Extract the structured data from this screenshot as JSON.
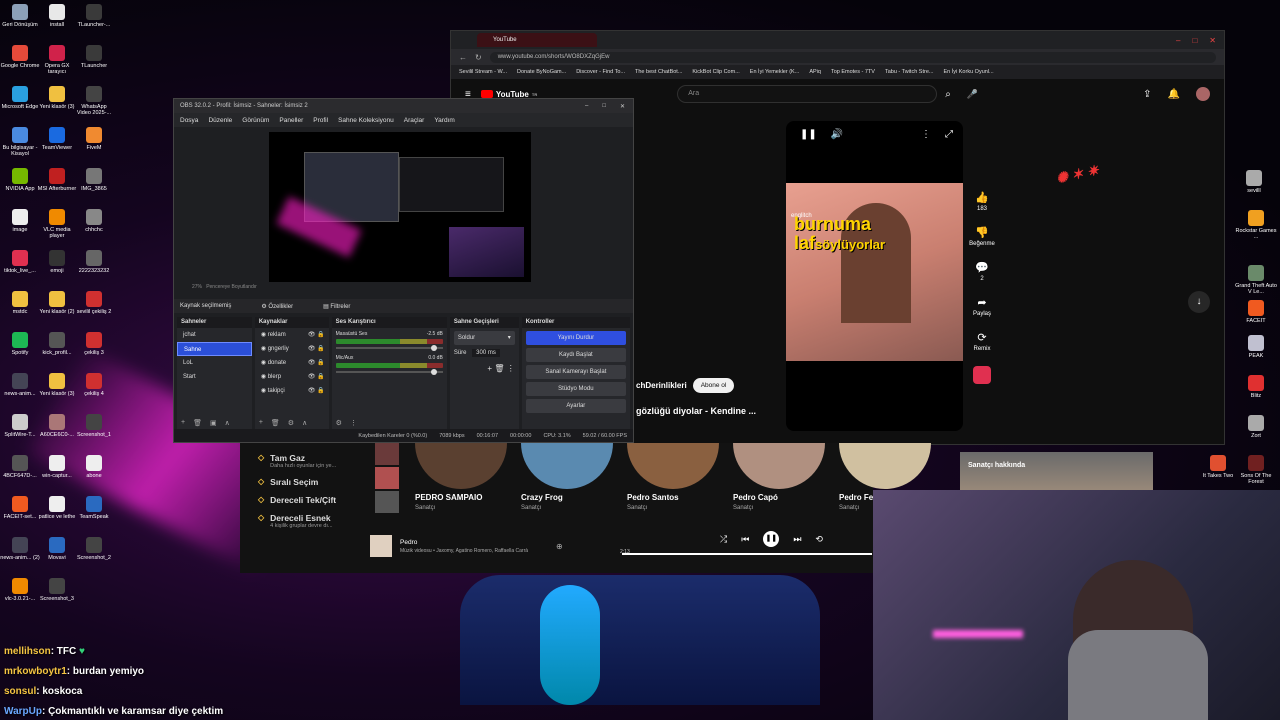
{
  "desktop_left": [
    {
      "label": "Geri Dönüşüm",
      "color": "#8ca0b8"
    },
    {
      "label": "install",
      "color": "#e8e8e8"
    },
    {
      "label": "TLauncher-...",
      "color": "#3a3a3a"
    },
    {
      "label": "Google Chrome",
      "color": "#e54a3a"
    },
    {
      "label": "Opera GX tarayıcı",
      "color": "#d0224a"
    },
    {
      "label": "TLauncher",
      "color": "#3a3a3a"
    },
    {
      "label": "Microsoft Edge",
      "color": "#2aa0e0"
    },
    {
      "label": "Yeni klasör (3)",
      "color": "#f0c040"
    },
    {
      "label": "WhatsApp Video 2025-...",
      "color": "#444"
    },
    {
      "label": "Bu bilgisayar - Kisayol",
      "color": "#4a8ae0"
    },
    {
      "label": "TeamViewer",
      "color": "#1a6ae0"
    },
    {
      "label": "FiveM",
      "color": "#f08a30"
    },
    {
      "label": "NVIDIA App",
      "color": "#76b900"
    },
    {
      "label": "MSI Afterburner",
      "color": "#c02020"
    },
    {
      "label": "IMG_3865",
      "color": "#777"
    },
    {
      "label": "image",
      "color": "#eee"
    },
    {
      "label": "VLC media player",
      "color": "#f08a00"
    },
    {
      "label": "chhchc",
      "color": "#888"
    },
    {
      "label": "tiktok_live_...",
      "color": "#e03050"
    },
    {
      "label": "emoji",
      "color": "#333"
    },
    {
      "label": "2222323232",
      "color": "#666"
    },
    {
      "label": "mstdc",
      "color": "#f0c040"
    },
    {
      "label": "Yeni klasör (2)",
      "color": "#f0c040"
    },
    {
      "label": "sevilil çekiliş 2",
      "color": "#d03030"
    },
    {
      "label": "Spotify",
      "color": "#1db954"
    },
    {
      "label": "kick_profil...",
      "color": "#555"
    },
    {
      "label": "çekiliş 3",
      "color": "#d03030"
    },
    {
      "label": "news-anim...",
      "color": "#445"
    },
    {
      "label": "Yeni klasör (3)",
      "color": "#f0c040"
    },
    {
      "label": "çekiliş 4",
      "color": "#d03030"
    },
    {
      "label": "SplitWire-T...",
      "color": "#ccc"
    },
    {
      "label": "A60CE6C0-...",
      "color": "#a77"
    },
    {
      "label": "Screenshot_1",
      "color": "#444"
    },
    {
      "label": "4BCF647D-...",
      "color": "#555"
    },
    {
      "label": "win-captur...",
      "color": "#eee"
    },
    {
      "label": "abone",
      "color": "#eee"
    },
    {
      "label": "FACEIT-set...",
      "color": "#f05a20"
    },
    {
      "label": "patlice ve lethe",
      "color": "#eee"
    },
    {
      "label": "TeamSpeak",
      "color": "#2a6ac0"
    },
    {
      "label": "news-anim... (2)",
      "color": "#445"
    },
    {
      "label": "Movavi",
      "color": "#2a6ac0"
    },
    {
      "label": "Screenshot_2",
      "color": "#444"
    },
    {
      "label": "vlc-3.0.21-...",
      "color": "#f08a00"
    },
    {
      "label": "Screenshot_3",
      "color": "#444"
    }
  ],
  "desktop_right": [
    {
      "label": "sevilll",
      "color": "#aaa"
    },
    {
      "label": "Rockstar Games ...",
      "color": "#f0a020"
    },
    {
      "label": "Grand Theft Auto V Le...",
      "color": "#6a8a6a"
    },
    {
      "label": "FACEIT",
      "color": "#f05a20"
    },
    {
      "label": "PEAK",
      "color": "#c0c0d0"
    },
    {
      "label": "Blitz",
      "color": "#e03030"
    },
    {
      "label": "Zort",
      "color": "#aaa"
    },
    {
      "label": "It Takes Two",
      "color": "#e05030"
    },
    {
      "label": "Sons Of The Forest",
      "color": "#702020"
    }
  ],
  "youtube": {
    "tab_title": "YouTube",
    "url": "www.youtube.com/shorts/WO8DXZqGjEw",
    "bookmarks": [
      "Sevilil Stream - W...",
      "Donate ByNoGam...",
      "Discover - Find To...",
      "The best ChatBot...",
      "KickBot Clip Com...",
      "En İyi Yemekler (K...",
      "APiq",
      "Top Emotes - 7TV",
      "Tabu - Twitch Stre...",
      "En İyi Korku Oyunl..."
    ],
    "logo": "YouTube",
    "logo_region": "TR",
    "search_placeholder": "Ara",
    "caption_line1": "burnuma",
    "caption_line2_a": "laf",
    "caption_line2_b": "söylüyorlar",
    "watermark": "englitch",
    "likes": "183",
    "dislike_label": "Beğenme",
    "comments": "2",
    "share_label": "Paylaş",
    "remix_label": "Remix",
    "channel": "chDerinlikleri",
    "subscribe_label": "Abone ol",
    "title": "gözlüğü diyolar - Kendine ..."
  },
  "obs": {
    "title": "OBS 32.0.2 - Profil: İsimsiz - Sahneler: İsimsiz 2",
    "menu": [
      "Dosya",
      "Düzenle",
      "Görünüm",
      "Paneller",
      "Profil",
      "Sahne Koleksiyonu",
      "Araçlar",
      "Yardım"
    ],
    "zoom": "27%",
    "zoom_mode": "Pencereye Boyutlandır",
    "no_source": "Kaynak seçilmemiş",
    "properties_label": "Özellikler",
    "filters_label": "Filtreler",
    "docks": {
      "scenes_title": "Sahneler",
      "scenes": [
        "jchat",
        "Sahne",
        "LoL",
        "Start"
      ],
      "sources_title": "Kaynaklar",
      "sources": [
        "reklam",
        "gngerliy",
        "donate",
        "blerp",
        "takipçi"
      ],
      "mixer_title": "Ses Karıştırıcı",
      "mixer": [
        {
          "name": "Masaüstü Ses",
          "db": "-2.5 dB"
        },
        {
          "name": "Mic/Aux",
          "db": "0.0 dB"
        }
      ],
      "transitions_title": "Sahne Geçişleri",
      "transition": "Soldur",
      "duration_label": "Süre",
      "duration": "300 ms",
      "controls_title": "Kontroller",
      "controls": [
        "Yayını Durdur",
        "Kaydı Başlat",
        "Sanal Kamerayı Başlat",
        "Stüdyo Modu",
        "Ayarlar"
      ]
    },
    "status": {
      "dropped": "Kaybedilen Kareler 0 (%0.0)",
      "bitrate": "7089 kbps",
      "stream_time": "00:16:07",
      "rec_time": "00:00:00",
      "cpu": "CPU: 3.1%",
      "fps": "59.02 / 60.00 FPS"
    }
  },
  "music": {
    "modes": [
      {
        "title": "Tam Gaz",
        "sub": "Daha hızlı oyunlar için ye..."
      },
      {
        "title": "Sıralı Seçim",
        "sub": ""
      },
      {
        "title": "Dereceli Tek/Çift",
        "sub": ""
      },
      {
        "title": "Dereceli Esnek",
        "sub": "4 kişilik gruplar devre dı..."
      }
    ],
    "artists": [
      {
        "name": "PEDRO SAMPAIO",
        "role": "Sanatçı",
        "color": "#5a4030"
      },
      {
        "name": "Crazy Frog",
        "role": "Sanatçı",
        "color": "#5a8ab0"
      },
      {
        "name": "Pedro Santos",
        "role": "Sanatçı",
        "color": "#8a6040"
      },
      {
        "name": "Pedro Capó",
        "role": "Sanatçı",
        "color": "#b09080"
      },
      {
        "name": "Pedro Fe...",
        "role": "Sanatçı",
        "color": "#d0c0a0"
      }
    ],
    "now_playing": {
      "title": "Pedro",
      "subtitle": "Müzik videosu • Jaxomy, Agatino Romero, Raffaella Carrà",
      "time": "2:13"
    },
    "artist_card_title": "Sanatçı hakkında"
  },
  "chat": [
    {
      "user": "mellihson",
      "text": ": TFC",
      "emote": "♥"
    },
    {
      "user": "mrkowboytr1",
      "text": ": burdan yemiyo",
      "emote": ""
    },
    {
      "user": "sonsul",
      "text": ": koskoca",
      "emote": ""
    },
    {
      "user": "WarpUp",
      "text": ": Çokmantıklı ve karamsar diye çektim",
      "emote": ""
    }
  ]
}
